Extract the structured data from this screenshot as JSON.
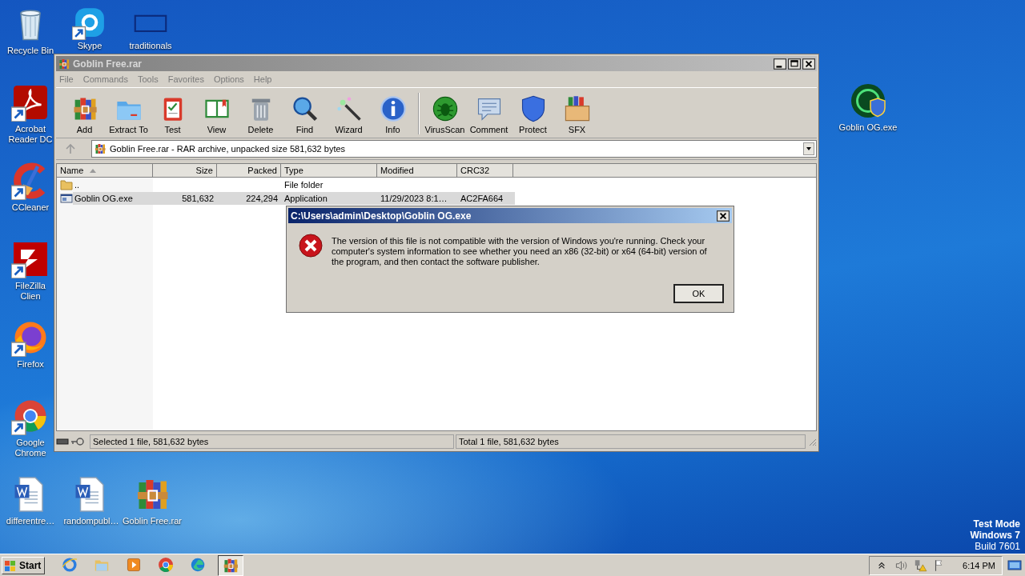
{
  "desktop": {
    "left_column": [
      {
        "kind": "trash",
        "label": "Recycle Bin",
        "shortcut": false
      },
      {
        "kind": "pdf",
        "label": "Acrobat Reader DC",
        "shortcut": true
      },
      {
        "kind": "cleaner",
        "label": "CCleaner",
        "shortcut": true
      },
      {
        "kind": "ftp",
        "label": "FileZilla Clien",
        "shortcut": true
      },
      {
        "kind": "firefox",
        "label": "Firefox",
        "shortcut": true
      },
      {
        "kind": "chrome",
        "label": "Google Chrome",
        "shortcut": true
      }
    ],
    "top_row": [
      {
        "kind": "chat",
        "label": "Skype",
        "shortcut": true
      },
      {
        "kind": "blank",
        "label": "traditionals",
        "shortcut": false
      }
    ],
    "bottom_row": [
      {
        "kind": "doc",
        "label": "differentre…",
        "shortcut": false
      },
      {
        "kind": "doc",
        "label": "randompubl…",
        "shortcut": false
      },
      {
        "kind": "archive",
        "label": "Goblin Free.rar",
        "shortcut": false
      }
    ],
    "right_column": [
      {
        "kind": "exe",
        "label": "Goblin OG.exe",
        "shortcut": false
      }
    ],
    "watermark": [
      "Test Mode",
      "Windows 7",
      "Build 7601"
    ]
  },
  "archive_window": {
    "title": "Goblin Free.rar",
    "active": false,
    "menu": [
      "File",
      "Commands",
      "Tools",
      "Favorites",
      "Options",
      "Help"
    ],
    "toolbar": [
      {
        "buttons": [
          {
            "kind": "add",
            "label": "Add"
          },
          {
            "kind": "extract",
            "label": "Extract To"
          },
          {
            "kind": "test",
            "label": "Test"
          },
          {
            "kind": "view",
            "label": "View"
          },
          {
            "kind": "delete",
            "label": "Delete"
          },
          {
            "kind": "find",
            "label": "Find"
          },
          {
            "kind": "wizard",
            "label": "Wizard"
          },
          {
            "kind": "info",
            "label": "Info"
          }
        ]
      },
      {
        "buttons": [
          {
            "kind": "virusscan",
            "label": "VirusScan"
          },
          {
            "kind": "comment",
            "label": "Comment"
          },
          {
            "kind": "protect",
            "label": "Protect"
          },
          {
            "kind": "sfx",
            "label": "SFX"
          }
        ]
      }
    ],
    "address": "Goblin Free.rar - RAR archive, unpacked size 581,632 bytes",
    "columns": [
      {
        "label": "Name",
        "sorted": true
      },
      {
        "label": "Size",
        "sorted": false
      },
      {
        "label": "Packed",
        "sorted": false
      },
      {
        "label": "Type",
        "sorted": false
      },
      {
        "label": "Modified",
        "sorted": false
      },
      {
        "label": "CRC32",
        "sorted": false
      }
    ],
    "rows": [
      {
        "kind": "folder",
        "name": "..",
        "type": "File folder",
        "selected": false
      },
      {
        "kind": "exe",
        "name": "Goblin OG.exe",
        "size": "581,632",
        "packed": "224,294",
        "type": "Application",
        "modified": "11/29/2023 8:1…",
        "crc32": "AC2FA664",
        "selected": true
      }
    ],
    "status": [
      "Selected 1 file, 581,632 bytes",
      "Total 1 file, 581,632 bytes"
    ]
  },
  "dialog": {
    "title": "C:\\Users\\admin\\Desktop\\Goblin OG.exe",
    "active": true,
    "kind": "error",
    "message": "The version of this file is not compatible with the version of Windows you're running. Check your computer's system information to see whether you need an x86 (32-bit) or x64 (64-bit) version of the program, and then contact the software publisher.",
    "buttons": [
      {
        "label": "OK",
        "default": true
      }
    ]
  },
  "taskbar": {
    "start": "Start",
    "pinned": [
      {
        "kind": "ie",
        "active": false
      },
      {
        "kind": "explorer",
        "active": false
      },
      {
        "kind": "media",
        "active": false
      },
      {
        "kind": "chrome",
        "active": false
      },
      {
        "kind": "edge",
        "active": false
      },
      {
        "kind": "winrar",
        "active": true
      }
    ],
    "tray": [
      {
        "kind": "chevron"
      },
      {
        "kind": "speaker"
      },
      {
        "kind": "network"
      },
      {
        "kind": "flag"
      }
    ],
    "clock": "6:14 PM"
  }
}
